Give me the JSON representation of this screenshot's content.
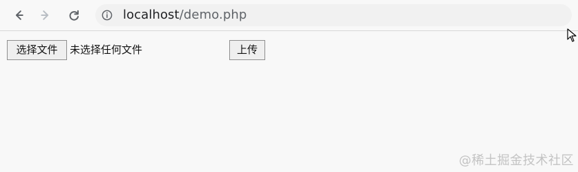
{
  "browser": {
    "url_host": "localhost",
    "url_path": "/demo.php"
  },
  "form": {
    "choose_file_label": "选择文件",
    "no_file_label": "未选择任何文件",
    "upload_label": "上传"
  },
  "watermark": {
    "text": "@稀土掘金技术社区"
  },
  "icons": {
    "back": "arrow-left-icon",
    "forward": "arrow-right-icon",
    "reload": "reload-icon",
    "info": "info-icon",
    "cursor": "mouse-pointer-icon"
  },
  "colors": {
    "background": "#f8f8f8",
    "address_bar": "#f1f1f1",
    "text": "#202124",
    "muted_text": "#5f6368",
    "watermark": "#c3c3c3",
    "button_border": "#8e8e8e",
    "button_fill": "#efefef"
  }
}
